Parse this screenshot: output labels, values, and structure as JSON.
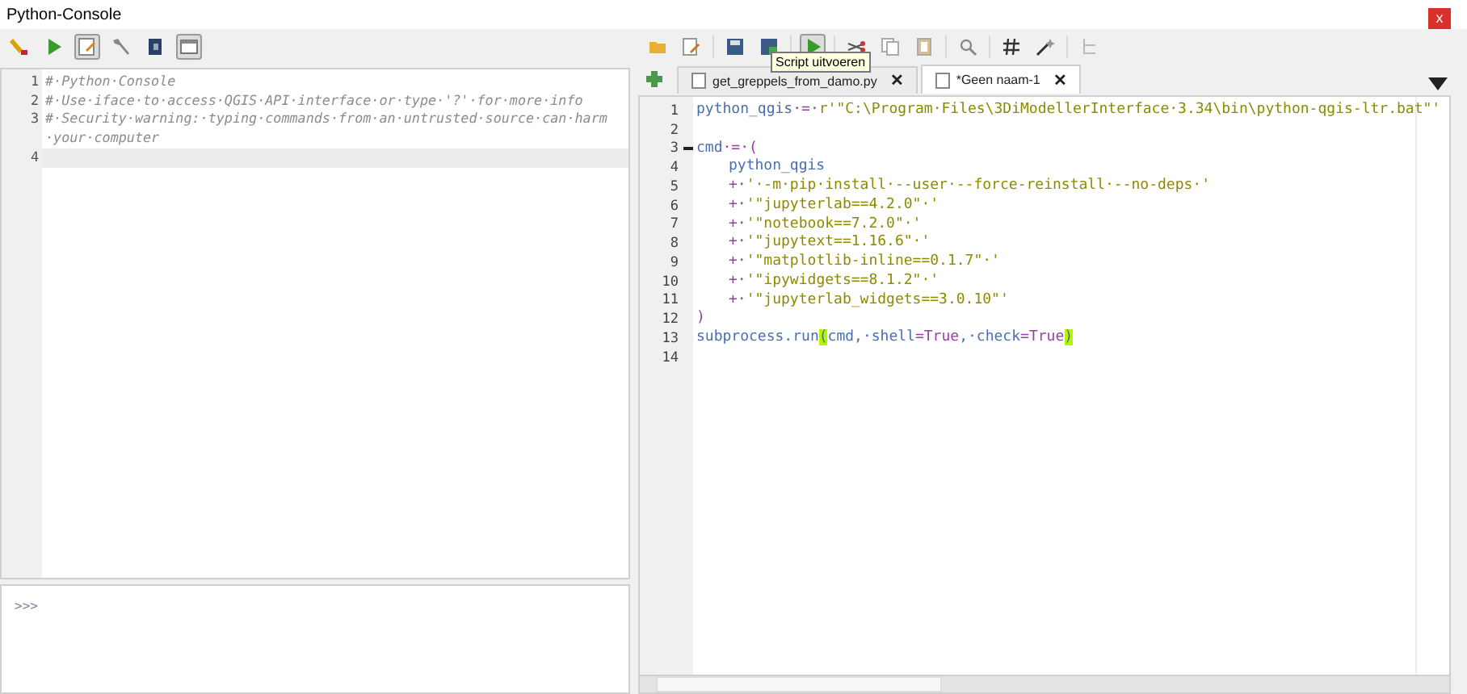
{
  "window": {
    "title": "Python-Console",
    "close": "x"
  },
  "console": {
    "toolbar": [
      {
        "kind": "clear",
        "active": false
      },
      {
        "kind": "run",
        "active": false
      },
      {
        "kind": "editor",
        "active": true
      },
      {
        "kind": "options",
        "active": false
      },
      {
        "kind": "help",
        "active": false
      },
      {
        "kind": "dock",
        "active": true
      }
    ],
    "lines": [
      {
        "number": "1",
        "text": "#·Python·Console",
        "current": false
      },
      {
        "number": "2",
        "text": "#·Use·iface·to·access·QGIS·API·interface·or·type·'?'·for·more·info",
        "current": false
      },
      {
        "number": "3",
        "text": "#·Security·warning:·typing·commands·from·an·untrusted·source·can·harm·your·computer",
        "current": false
      },
      {
        "number": "4",
        "current": true
      }
    ],
    "prompt": ">>>"
  },
  "editor": {
    "toolbar": [
      {
        "kind": "open",
        "active": false
      },
      {
        "kind": "open-external",
        "active": false
      },
      {
        "kind": "save",
        "active": false
      },
      {
        "kind": "save-as",
        "active": false
      },
      {
        "kind": "run",
        "active": true
      },
      {
        "kind": "cut",
        "active": false
      },
      {
        "kind": "copy",
        "active": false
      },
      {
        "kind": "paste",
        "active": false
      },
      {
        "kind": "find",
        "active": false
      },
      {
        "kind": "comment",
        "active": false
      },
      {
        "kind": "object-inspector",
        "active": false
      },
      {
        "kind": "list",
        "active": false
      }
    ],
    "tooltip": "Script uitvoeren",
    "tabs": [
      {
        "label": "get_greppels_from_damo.py",
        "close": "✕",
        "selected": false
      },
      {
        "label": "*Geen naam-1",
        "close": "✕",
        "selected": true
      }
    ],
    "lines": [
      {
        "number": "1",
        "indented": false,
        "fold": false,
        "tokens": [
          {
            "kind": "ident",
            "text": "python_qgis"
          },
          {
            "kind": "op",
            "text": "·=·"
          },
          {
            "kind": "string",
            "text": "r'\"C:\\Program·Files\\3DiModellerInterface·3.34\\bin\\python-qgis-ltr.bat\"'"
          }
        ]
      },
      {
        "number": "2",
        "fold": false
      },
      {
        "number": "3",
        "indented": false,
        "fold": true,
        "tokens": [
          {
            "kind": "ident",
            "text": "cmd"
          },
          {
            "kind": "op",
            "text": "·=·("
          }
        ]
      },
      {
        "number": "4",
        "indented": true,
        "fold": false,
        "tokens": [
          {
            "kind": "ident",
            "text": "python_qgis"
          }
        ]
      },
      {
        "number": "5",
        "indented": true,
        "fold": false,
        "tokens": [
          {
            "kind": "op",
            "text": "+·"
          },
          {
            "kind": "string",
            "text": "'·-m·pip·install·--user·--force-reinstall·--no-deps·'"
          }
        ]
      },
      {
        "number": "6",
        "indented": true,
        "fold": false,
        "tokens": [
          {
            "kind": "op",
            "text": "+·"
          },
          {
            "kind": "string",
            "text": "'\"jupyterlab==4.2.0\"·'"
          }
        ]
      },
      {
        "number": "7",
        "indented": true,
        "fold": false,
        "tokens": [
          {
            "kind": "op",
            "text": "+·"
          },
          {
            "kind": "string",
            "text": "'\"notebook==7.2.0\"·'"
          }
        ]
      },
      {
        "number": "8",
        "indented": true,
        "fold": false,
        "tokens": [
          {
            "kind": "op",
            "text": "+·"
          },
          {
            "kind": "string",
            "text": "'\"jupytext==1.16.6\"·'"
          }
        ]
      },
      {
        "number": "9",
        "indented": true,
        "fold": false,
        "tokens": [
          {
            "kind": "op",
            "text": "+·"
          },
          {
            "kind": "string",
            "text": "'\"matplotlib-inline==0.1.7\"·'"
          }
        ]
      },
      {
        "number": "10",
        "indented": true,
        "fold": false,
        "tokens": [
          {
            "kind": "op",
            "text": "+·"
          },
          {
            "kind": "string",
            "text": "'\"ipywidgets==8.1.2\"·'"
          }
        ]
      },
      {
        "number": "11",
        "indented": true,
        "fold": false,
        "tokens": [
          {
            "kind": "op",
            "text": "+·"
          },
          {
            "kind": "string",
            "text": "'\"jupyterlab_widgets==3.0.10\"'"
          }
        ]
      },
      {
        "number": "12",
        "indented": false,
        "fold": false,
        "tokens": [
          {
            "kind": "op",
            "text": ")"
          }
        ]
      },
      {
        "number": "13",
        "indented": false,
        "fold": false,
        "tokens": [
          {
            "kind": "ident",
            "text": "subprocess.run"
          },
          {
            "kind": "brace",
            "text": "("
          },
          {
            "kind": "ident",
            "text": "cmd,·shell"
          },
          {
            "kind": "op",
            "text": "="
          },
          {
            "kind": "keyword",
            "text": "True"
          },
          {
            "kind": "ident",
            "text": ",·check"
          },
          {
            "kind": "op",
            "text": "="
          },
          {
            "kind": "keyword",
            "text": "True"
          },
          {
            "kind": "brace",
            "text": ")"
          }
        ]
      },
      {
        "number": "14",
        "fold": false
      }
    ]
  }
}
